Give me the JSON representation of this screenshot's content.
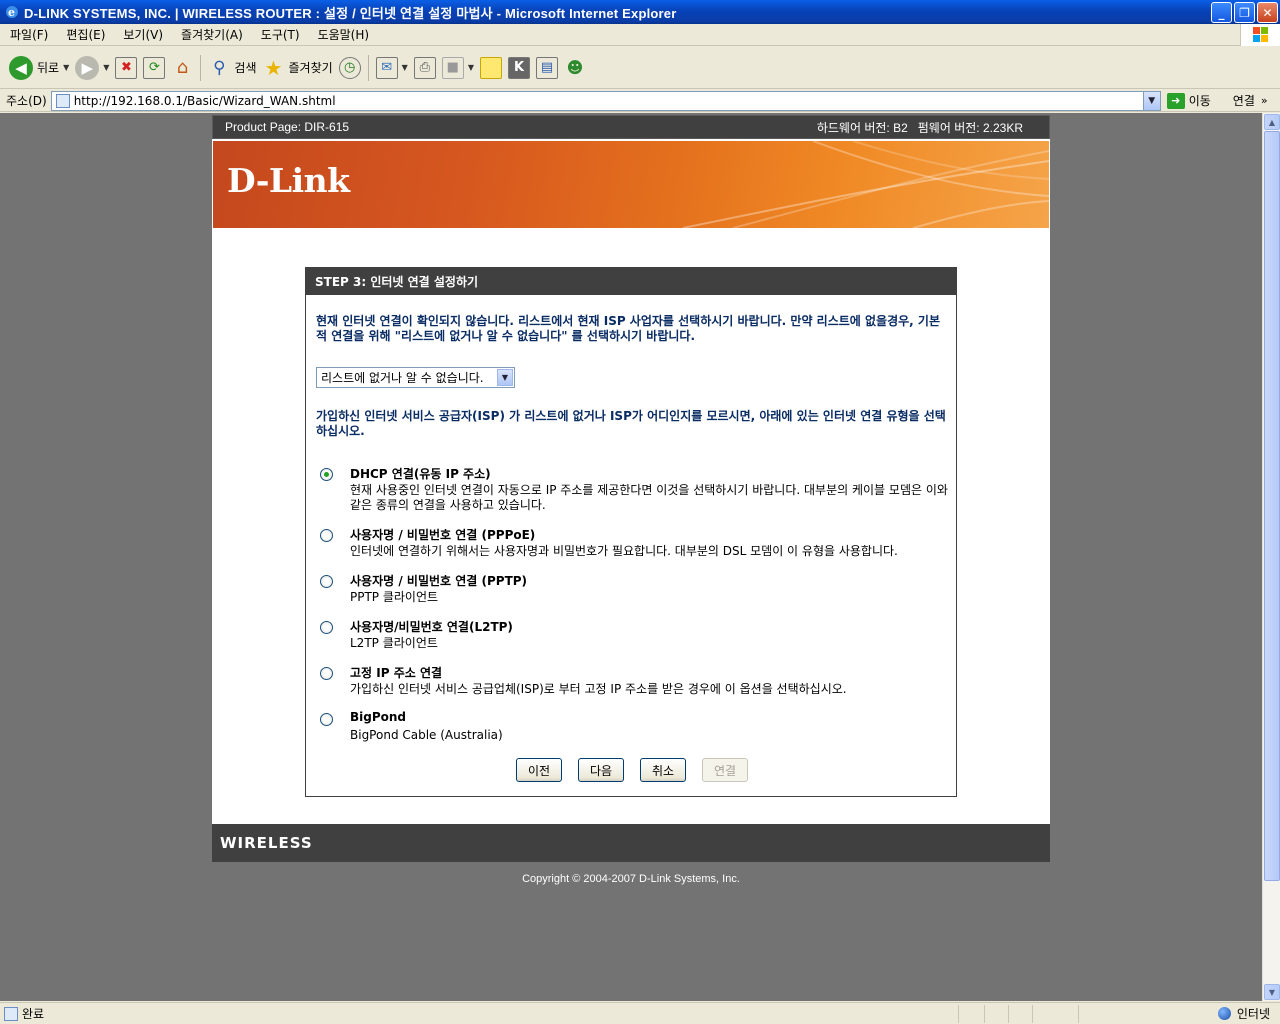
{
  "window": {
    "title": "D-LINK SYSTEMS, INC. | WIRELESS ROUTER : 설정 / 인터넷 연결 설정 마법사 - Microsoft Internet Explorer"
  },
  "menu": [
    "파일(F)",
    "편집(E)",
    "보기(V)",
    "즐겨찾기(A)",
    "도구(T)",
    "도움말(H)"
  ],
  "toolbar": {
    "back_label": "뒤로",
    "search_label": "검색",
    "favorites_label": "즐겨찾기"
  },
  "address": {
    "label": "주소(D)",
    "url": "http://192.168.0.1/Basic/Wizard_WAN.shtml",
    "go_label": "이동",
    "links_label": "연결"
  },
  "router_page": {
    "product_page": "Product Page: DIR-615",
    "versions": "하드웨어 버전: B2   펌웨어 버전: 2.23KR",
    "logo": "D-Link",
    "wizard_title": "STEP 3: 인터넷 연결 설정하기",
    "intro_text": "현재 인터넷 연결이 확인되지 않습니다. 리스트에서 현재 ISP 사업자를 선택하시기 바랍니다. 만약 리스트에 없을경우, 기본적 연결을 위해 \"리스트에 없거나 알 수 없습니다\" 를 선택하시기 바랍니다.",
    "isp_select_value": "리스트에 없거나 알 수 없습니다.",
    "notice_text": "가입하신 인터넷 서비스 공급자(ISP) 가 리스트에 없거나 ISP가 어디인지를 모르시면, 아래에 있는 인터넷 연결 유형을 선택하십시오.",
    "options": [
      {
        "title": "DHCP 연결(유동 IP 주소)",
        "desc": "현재 사용중인 인터넷 연결이 자동으로 IP 주소를 제공한다면 이것을 선택하시기 바랍니다. 대부분의 케이블 모뎀은 이와 같은 종류의 연결을 사용하고 있습니다.",
        "selected": true
      },
      {
        "title": "사용자명 / 비밀번호 연결 (PPPoE)",
        "desc": "인터넷에 연결하기 위해서는 사용자명과 비밀번호가 필요합니다. 대부분의 DSL 모뎀이 이 유형을 사용합니다.",
        "selected": false
      },
      {
        "title": "사용자명 / 비밀번호 연결 (PPTP)",
        "desc": "PPTP 클라이언트",
        "selected": false
      },
      {
        "title": "사용자명/비밀번호 연결(L2TP)",
        "desc": "L2TP 클라이언트",
        "selected": false
      },
      {
        "title": "고정 IP 주소 연결",
        "desc": "가입하신 인터넷 서비스 공급업체(ISP)로 부터 고정 IP 주소를 받은 경우에 이 옵션을 선택하십시오.",
        "selected": false
      },
      {
        "title": "BigPond",
        "desc": "BigPond Cable (Australia)",
        "selected": false
      }
    ],
    "buttons": {
      "prev": "이전",
      "next": "다음",
      "cancel": "취소",
      "connect": "연결"
    },
    "footer_brand": "WIRELESS",
    "copyright": "Copyright © 2004-2007 D-Link Systems, Inc."
  },
  "status": {
    "text": "완료",
    "zone": "인터넷"
  },
  "colors": {
    "title_bar": "#0842b8",
    "router_dark": "#404040",
    "banner_orange": "#e4701d",
    "wizard_blue_text": "#0a2c64",
    "viewport_bg": "#737373"
  }
}
